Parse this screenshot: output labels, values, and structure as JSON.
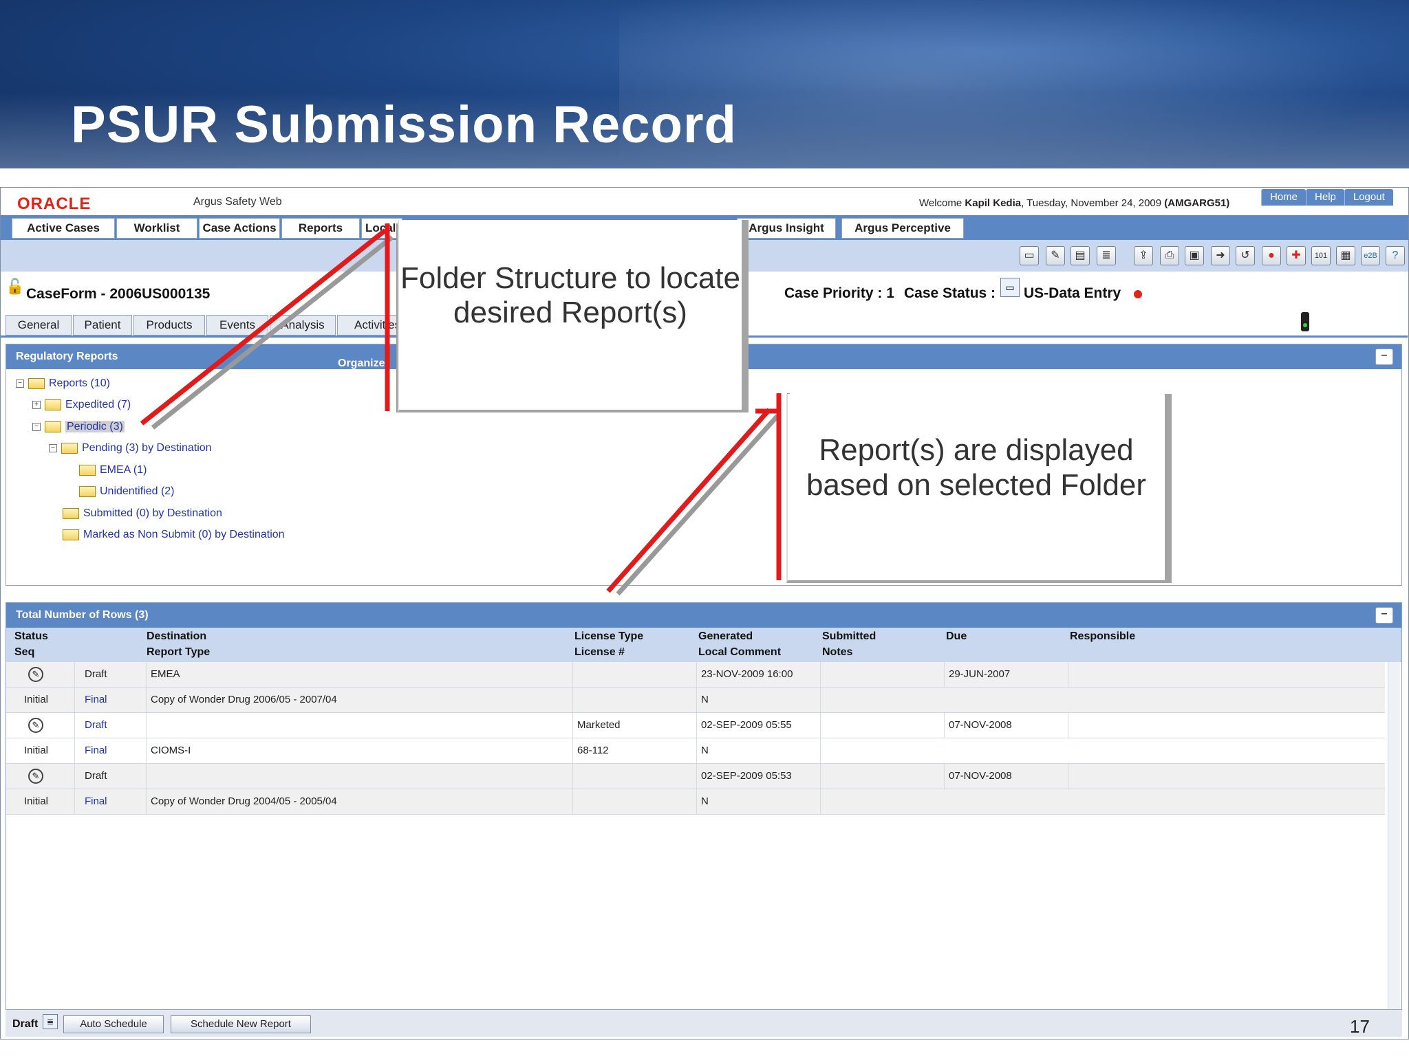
{
  "slide": {
    "title": "PSUR Submission Record",
    "page_number": "17"
  },
  "app": {
    "logo": "ORACLE",
    "name": "Argus Safety Web",
    "welcome_prefix": "Welcome",
    "user": "Kapil Kedia",
    "date": ", Tuesday, November 24, 2009",
    "user_code": "(AMGARG51)",
    "top_links": [
      "Home",
      "Help",
      "Logout"
    ]
  },
  "nav": {
    "tabs": [
      "Active Cases",
      "Worklist",
      "Case Actions",
      "Reports",
      "Local",
      "Argus Insight",
      "Argus Perceptive"
    ]
  },
  "toolbar": {
    "icons": [
      "print-preview-icon",
      "new-case-icon",
      "open-folder-icon",
      "list-icon",
      "export-icon",
      "print-icon",
      "save-icon",
      "forward-icon",
      "route-icon",
      "close-icon",
      "medwatch-icon",
      "cioms-icon",
      "draft-icon",
      "e2b-icon",
      "help-icon"
    ]
  },
  "case": {
    "title": "CaseForm - 2006US000135",
    "priority_label": "Case Priority : 1",
    "status_label": "Case Status :",
    "status_value": "US-Data Entry"
  },
  "subtabs": [
    "General",
    "Patient",
    "Products",
    "Events",
    "Analysis",
    "Activities"
  ],
  "regulatory_panel": {
    "title": "Regulatory Reports",
    "organize_label": "Organize",
    "tree": [
      {
        "label": "Reports (10)",
        "expander": "−"
      },
      {
        "label": "Expedited (7)",
        "expander": "+"
      },
      {
        "label": "Periodic (3)",
        "expander": "−"
      },
      {
        "label": "Pending (3) by Destination",
        "expander": "−"
      },
      {
        "label": "EMEA (1)",
        "expander": ""
      },
      {
        "label": "Unidentified (2)",
        "expander": ""
      },
      {
        "label": "Submitted (0) by Destination",
        "expander": ""
      },
      {
        "label": "Marked as Non Submit (0) by Destination",
        "expander": ""
      }
    ]
  },
  "grid_panel": {
    "title": "Total Number of Rows (3)",
    "headers": {
      "status": "Status",
      "seq": "Seq",
      "destination": "Destination",
      "report_type": "Report Type",
      "license_type": "License Type",
      "license_no": "License #",
      "generated": "Generated",
      "local_comment": "Local Comment",
      "submitted": "Submitted",
      "notes": "Notes",
      "due": "Due",
      "responsible": "Responsible"
    },
    "rows": [
      {
        "r1_status": "Draft",
        "r1_destination": "EMEA",
        "r1_license_type": "",
        "r1_generated": "23-NOV-2009 16:00",
        "r1_submitted": "",
        "r1_due": "29-JUN-2007",
        "r1_responsible": "",
        "r2_seq": "Initial",
        "r2_final": "Final",
        "r2_report_type": "Copy of Wonder Drug 2006/05 - 2007/04",
        "r2_license_no": "",
        "r2_local_comment": "N",
        "r2_notes": ""
      },
      {
        "r1_status": "Draft",
        "r1_destination": "",
        "r1_license_type": "Marketed",
        "r1_generated": "02-SEP-2009 05:55",
        "r1_submitted": "",
        "r1_due": "07-NOV-2008",
        "r1_responsible": "",
        "r2_seq": "Initial",
        "r2_final": "Final",
        "r2_report_type": "CIOMS-I",
        "r2_license_no": "68-112",
        "r2_local_comment": "N",
        "r2_notes": ""
      },
      {
        "r1_status": "Draft",
        "r1_destination": "",
        "r1_license_type": "",
        "r1_generated": "02-SEP-2009 05:53",
        "r1_submitted": "",
        "r1_due": "07-NOV-2008",
        "r1_responsible": "",
        "r2_seq": "Initial",
        "r2_final": "Final",
        "r2_report_type": "Copy of Wonder Drug 2004/05 - 2005/04",
        "r2_license_no": "",
        "r2_local_comment": "N",
        "r2_notes": ""
      }
    ]
  },
  "bottom_bar": {
    "draft_label": "Draft",
    "auto_schedule": "Auto Schedule",
    "schedule_new_report": "Schedule New Report"
  },
  "callouts": {
    "folder_structure": "Folder Structure to locate desired Report(s)",
    "report_display": "Report(s) are displayed based on selected Folder"
  },
  "colors": {
    "accent_blue": "#5b87c5",
    "oracle_red": "#e2231a",
    "arrow_red": "#e21a1a",
    "link_blue": "#2233aa"
  }
}
